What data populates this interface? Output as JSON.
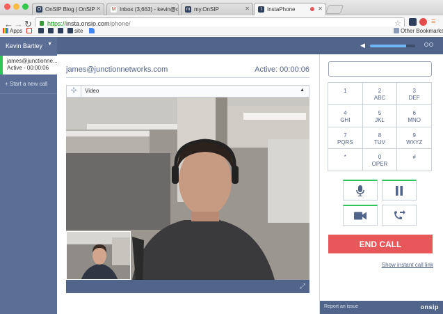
{
  "browser": {
    "tabs": [
      {
        "title": "OnSIP Blog | OnSIP",
        "favicon": "O"
      },
      {
        "title": "Inbox (3,663) - kevin@on",
        "favicon": "M"
      },
      {
        "title": "my.OnSIP",
        "favicon": "m"
      },
      {
        "title": "InstaPhone",
        "favicon": "I"
      }
    ],
    "url_scheme": "https://",
    "url_host": "insta.onsip.com",
    "url_path": "/phone/",
    "bookmarks": [
      {
        "label": "Apps",
        "icon": "apps-grid-icon"
      },
      {
        "label": "",
        "icon": "gmail-icon"
      },
      {
        "label": "",
        "icon": "onsip-icon"
      },
      {
        "label": "",
        "icon": "onsip-icon"
      },
      {
        "label": "",
        "icon": "onsip-icon"
      },
      {
        "label": "site",
        "icon": "onsip-icon"
      },
      {
        "label": "",
        "icon": "adwords-icon"
      }
    ],
    "other_bookmarks": "Other Bookmarks"
  },
  "header": {
    "user_name": "Kevin Bartley",
    "volume_level": 0.8
  },
  "sidebar": {
    "active_call": {
      "name": "james@junctionne...",
      "status": "Active - 00:00:06"
    },
    "new_call_label": "+ Start a new call"
  },
  "call": {
    "callee": "james@junctionnetworks.com",
    "status": "Active: 00:00:06",
    "video_label": "Video"
  },
  "keypad": [
    {
      "digit": "1",
      "letters": ""
    },
    {
      "digit": "2",
      "letters": "ABC"
    },
    {
      "digit": "3",
      "letters": "DEF"
    },
    {
      "digit": "4",
      "letters": "GHI"
    },
    {
      "digit": "5",
      "letters": "JKL"
    },
    {
      "digit": "6",
      "letters": "MNO"
    },
    {
      "digit": "7",
      "letters": "PQRS"
    },
    {
      "digit": "8",
      "letters": "TUV"
    },
    {
      "digit": "9",
      "letters": "WXYZ"
    },
    {
      "digit": "*",
      "letters": ""
    },
    {
      "digit": "0",
      "letters": "OPER"
    },
    {
      "digit": "#",
      "letters": ""
    }
  ],
  "controls": {
    "end_call_label": "END CALL",
    "instant_link_label": "Show instant call link"
  },
  "footer": {
    "report_label": "Report an issue",
    "logo_text": "onsip"
  },
  "colors": {
    "brand_navy": "#51648a",
    "active_green": "#2cc45b",
    "end_call_red": "#e8575a"
  }
}
